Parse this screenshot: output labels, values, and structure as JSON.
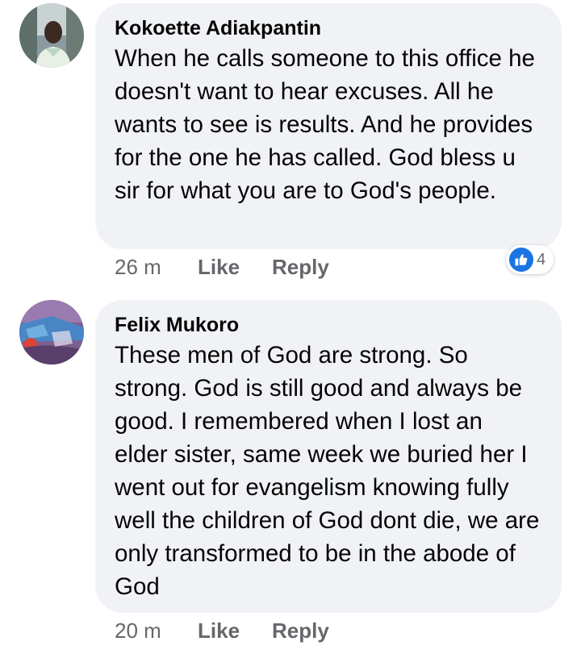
{
  "comments": [
    {
      "author": "Kokoette Adiakpantin",
      "text": "When he calls someone to this office he doesn't want to hear excuses. All he wants to see is results. And he provides for the one he has called. God bless u sir for what you are to God's people.",
      "time": "26 m",
      "like_label": "Like",
      "reply_label": "Reply",
      "reaction": {
        "icon": "thumbs-up-icon",
        "count": "4",
        "color": "#1b74e4"
      }
    },
    {
      "author": "Felix Mukoro",
      "text": "These men of God are strong. So strong. God is still good and always be good. I remembered when I lost an elder sister, same week we buried her I went out for evangelism knowing fully well the children of God dont die, we are only transformed to be in the abode of God",
      "time": "20 m",
      "like_label": "Like",
      "reply_label": "Reply"
    }
  ],
  "colors": {
    "bubble": "#f0f2f5",
    "meta_text": "#65676b",
    "text": "#050505"
  }
}
